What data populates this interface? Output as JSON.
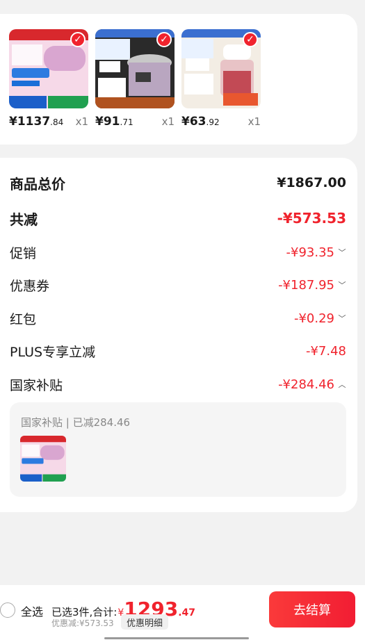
{
  "products": [
    {
      "image": "water-heater-product-image",
      "price_symbol": "¥",
      "price_int": "1137",
      "price_dec": ".84",
      "qty": "x1"
    },
    {
      "image": "pressure-cooker-product-image",
      "price_symbol": "¥",
      "price_int": "91",
      "price_dec": ".71",
      "qty": "x1"
    },
    {
      "image": "food-chopper-product-image",
      "price_symbol": "¥",
      "price_int": "63",
      "price_dec": ".92",
      "qty": "x1"
    }
  ],
  "summary": {
    "goods_total_label": "商品总价",
    "goods_total_value": "¥1867.00",
    "total_reduce_label": "共减",
    "total_reduce_value": "-¥573.53",
    "promo_label": "促销",
    "promo_value": "-¥93.35",
    "coupon_label": "优惠券",
    "coupon_value": "-¥187.95",
    "redpacket_label": "红包",
    "redpacket_value": "-¥0.29",
    "plus_label": "PLUS专享立减",
    "plus_value": "-¥7.48",
    "subsidy_label": "国家补贴",
    "subsidy_value": "-¥284.46"
  },
  "subsidy_detail": {
    "title": "国家补贴 | 已减284.46"
  },
  "bottom": {
    "select_all": "全选",
    "selected_info": "已选3件,合计:",
    "total_symbol": "¥",
    "total_int": "1293",
    "total_dec": ".47",
    "discount_line": "优惠减:¥573.53",
    "detail_button": "优惠明细",
    "checkout_button": "去结算"
  },
  "colors": {
    "accent": "#f0232d",
    "background": "#f2f2f2"
  }
}
